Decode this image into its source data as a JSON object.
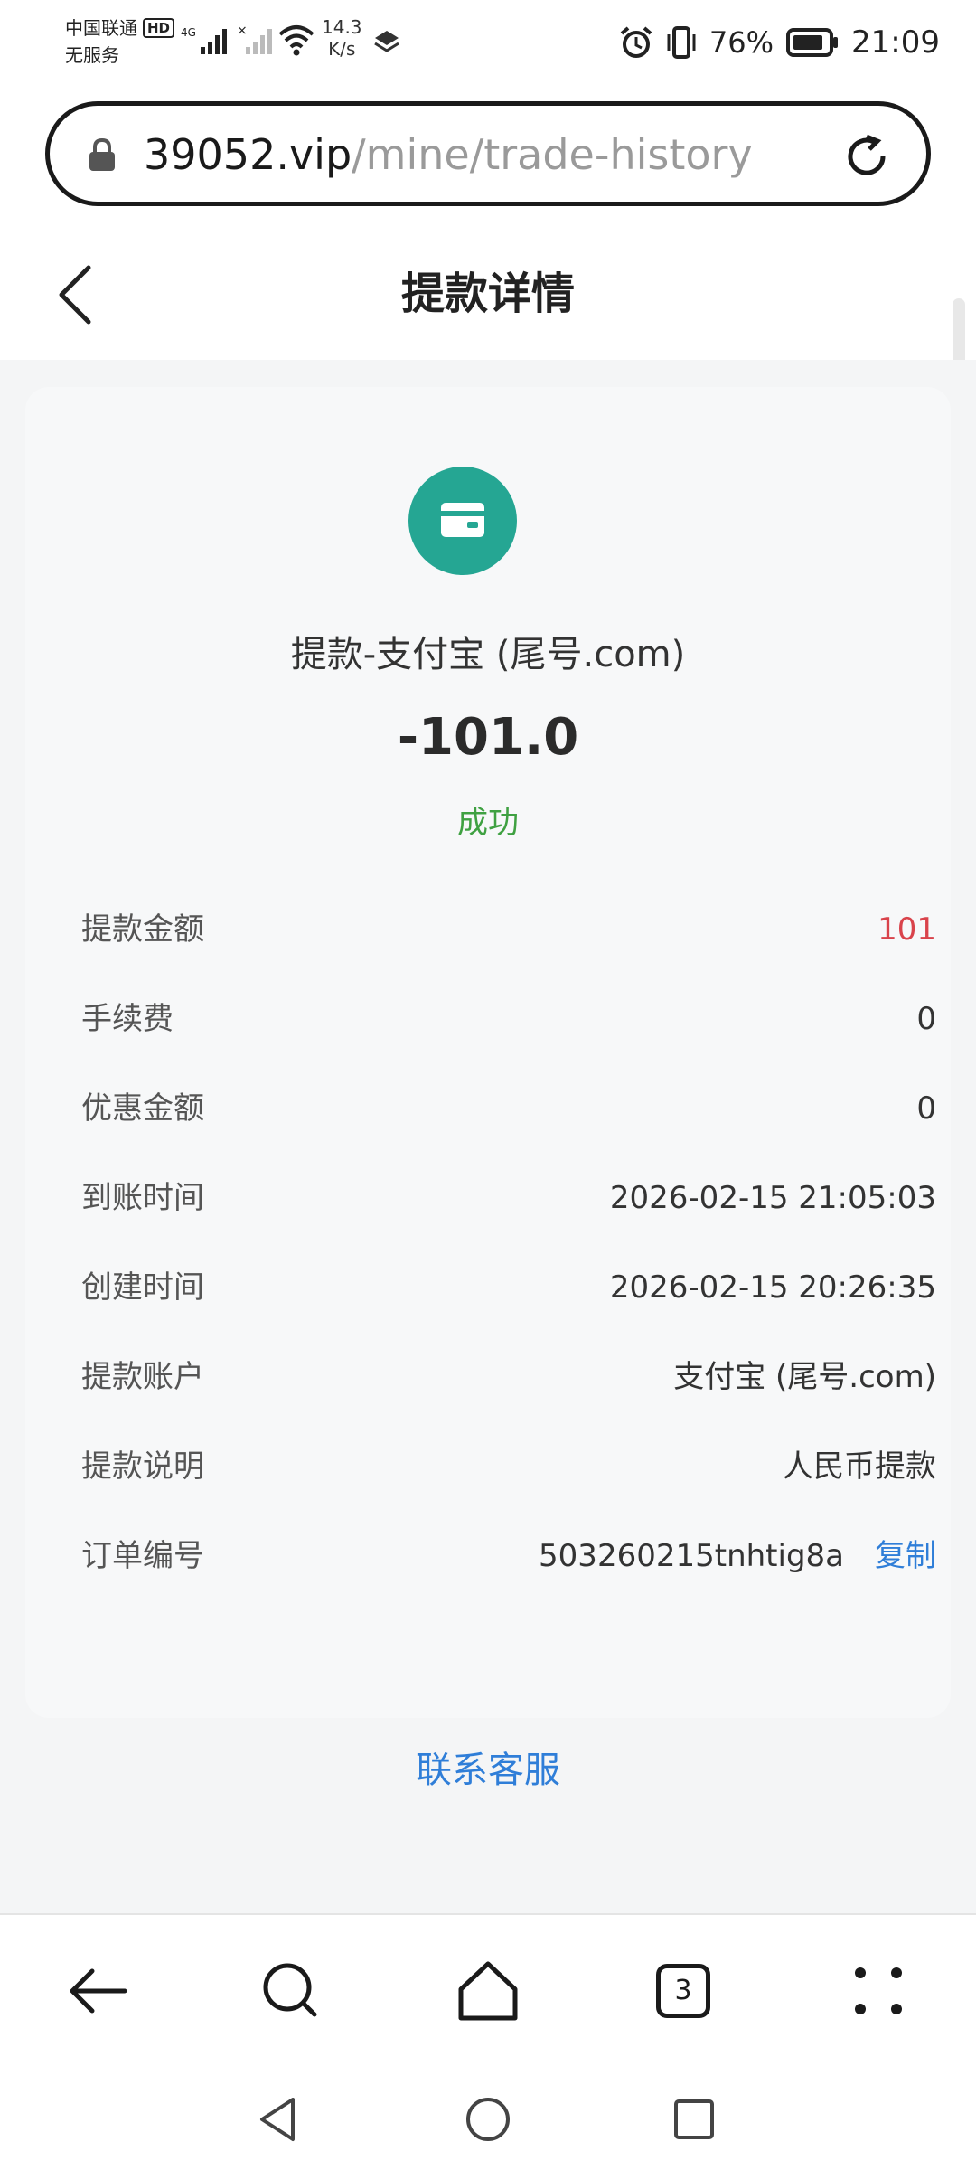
{
  "status_bar": {
    "carrier_line1": "中国联通",
    "hd_badge": "HD",
    "carrier_line2": "无服务",
    "net_speed_value": "14.3",
    "net_speed_unit": "K/s",
    "battery_percent": "76%",
    "time": "21:09"
  },
  "url_bar": {
    "domain": "39052.vip",
    "path": "/mine/trade-history"
  },
  "header": {
    "title": "提款详情"
  },
  "summary": {
    "method": "提款-支付宝 (尾号.com)",
    "amount": "-101.0",
    "status": "成功",
    "icon_color": "#25a693",
    "status_color": "#3fa142"
  },
  "details": {
    "withdraw_amount_label": "提款金额",
    "withdraw_amount_value": "101",
    "fee_label": "手续费",
    "fee_value": "0",
    "discount_label": "优惠金额",
    "discount_value": "0",
    "arrival_time_label": "到账时间",
    "arrival_time_value": "2026-02-15 21:05:03",
    "created_time_label": "创建时间",
    "created_time_value": "2026-02-15 20:26:35",
    "account_label": "提款账户",
    "account_value": "支付宝 (尾号.com)",
    "note_label": "提款说明",
    "note_value": "人民币提款",
    "order_label": "订单编号",
    "order_value": "503260215tnhtig8a",
    "copy_label": "复制"
  },
  "contact_support": "联系客服",
  "browser_toolbar": {
    "back_icon": "arrow-left-icon",
    "search_icon": "search-icon",
    "home_icon": "home-icon",
    "tabs_count": "3",
    "menu_icon": "more-dots-icon"
  },
  "colors": {
    "accent_link": "#2f7ed8",
    "amount_red": "#d9434b"
  }
}
